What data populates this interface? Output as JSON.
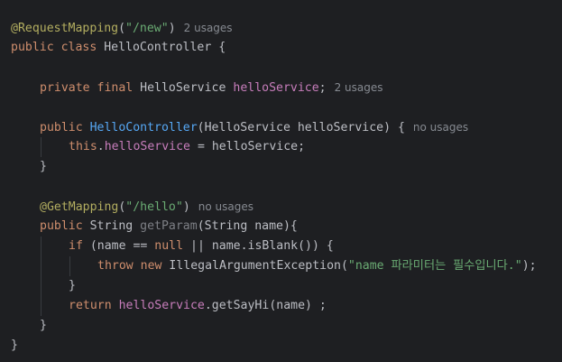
{
  "editor": {
    "lines": [
      {
        "indent": 0,
        "tokens": [
          {
            "text": "@RequestMapping",
            "kind": "ann"
          },
          {
            "text": "(",
            "kind": "plain"
          },
          {
            "text": "\"/new\"",
            "kind": "str"
          },
          {
            "text": ")",
            "kind": "plain"
          }
        ],
        "hint": "2 usages"
      },
      {
        "indent": 0,
        "tokens": [
          {
            "text": "public class ",
            "kind": "kw"
          },
          {
            "text": "HelloController {",
            "kind": "plain"
          }
        ]
      },
      {
        "indent": 0,
        "tokens": []
      },
      {
        "indent": 1,
        "tokens": [
          {
            "text": "private final ",
            "kind": "kw"
          },
          {
            "text": "HelloService ",
            "kind": "plain"
          },
          {
            "text": "helloService",
            "kind": "field"
          },
          {
            "text": ";",
            "kind": "plain"
          }
        ],
        "hint": "2 usages"
      },
      {
        "indent": 0,
        "tokens": []
      },
      {
        "indent": 1,
        "tokens": [
          {
            "text": "public ",
            "kind": "kw"
          },
          {
            "text": "HelloController",
            "kind": "decl"
          },
          {
            "text": "(HelloService helloService) {",
            "kind": "plain"
          }
        ],
        "hint": "no usages"
      },
      {
        "indent": 2,
        "tokens": [
          {
            "text": "this",
            "kind": "kw"
          },
          {
            "text": ".",
            "kind": "plain"
          },
          {
            "text": "helloService",
            "kind": "field"
          },
          {
            "text": " = helloService;",
            "kind": "plain"
          }
        ]
      },
      {
        "indent": 1,
        "tokens": [
          {
            "text": "}",
            "kind": "plain"
          }
        ]
      },
      {
        "indent": 0,
        "tokens": []
      },
      {
        "indent": 1,
        "tokens": [
          {
            "text": "@GetMapping",
            "kind": "ann"
          },
          {
            "text": "(",
            "kind": "plain"
          },
          {
            "text": "\"/hello\"",
            "kind": "str"
          },
          {
            "text": ")",
            "kind": "plain"
          }
        ],
        "hint": "no usages"
      },
      {
        "indent": 1,
        "tokens": [
          {
            "text": "public ",
            "kind": "kw"
          },
          {
            "text": "String ",
            "kind": "plain"
          },
          {
            "text": "getParam",
            "kind": "unused"
          },
          {
            "text": "(String name){",
            "kind": "plain"
          }
        ]
      },
      {
        "indent": 2,
        "tokens": [
          {
            "text": "if ",
            "kind": "kw"
          },
          {
            "text": "(name == ",
            "kind": "plain"
          },
          {
            "text": "null ",
            "kind": "kw"
          },
          {
            "text": "|| name.isBlank()) {",
            "kind": "plain"
          }
        ]
      },
      {
        "indent": 3,
        "tokens": [
          {
            "text": "throw new ",
            "kind": "kw"
          },
          {
            "text": "IllegalArgumentException(",
            "kind": "plain"
          },
          {
            "text": "\"name 파라미터는 필수입니다.\"",
            "kind": "str"
          },
          {
            "text": ");",
            "kind": "plain"
          }
        ]
      },
      {
        "indent": 2,
        "tokens": [
          {
            "text": "}",
            "kind": "plain"
          }
        ]
      },
      {
        "indent": 2,
        "tokens": [
          {
            "text": "return ",
            "kind": "kw"
          },
          {
            "text": "helloService",
            "kind": "field"
          },
          {
            "text": ".getSayHi(name) ;",
            "kind": "plain"
          }
        ]
      },
      {
        "indent": 1,
        "tokens": [
          {
            "text": "}",
            "kind": "plain"
          }
        ]
      },
      {
        "indent": 0,
        "tokens": [
          {
            "text": "}",
            "kind": "plain"
          }
        ]
      }
    ],
    "colors": {
      "background": "#1e1f22",
      "keyword": "#cf8e6d",
      "annotation": "#b3ae60",
      "string": "#6aab73",
      "field": "#c77dbb",
      "method_declaration": "#56a8f5",
      "unused_method": "#7d7f85",
      "plain": "#bcbec4",
      "inlay_hint": "#868a91"
    }
  }
}
